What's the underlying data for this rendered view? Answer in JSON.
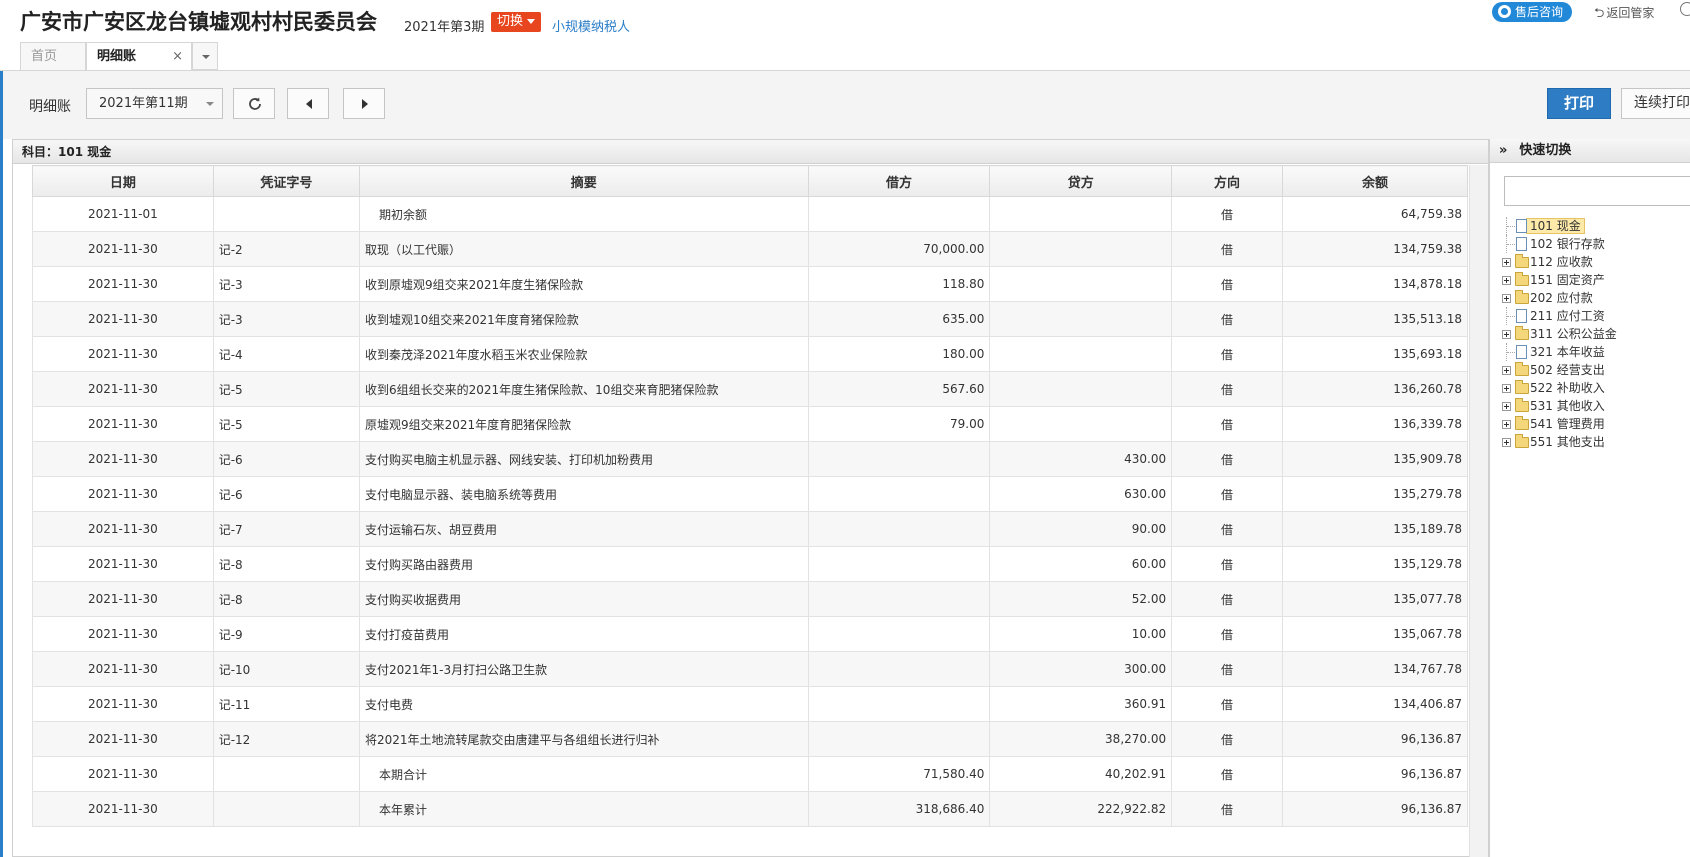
{
  "header": {
    "company": "广安市广安区龙台镇墟观村村民委员会",
    "period": "2021年第3期",
    "switch_label": "切换",
    "taxpayer": "小规模纳税人",
    "support_label": "售后咨询",
    "back_label": "返回管家"
  },
  "tabs": [
    {
      "label": "首页"
    },
    {
      "label": "明细账",
      "close": "×"
    }
  ],
  "toolbar": {
    "label": "明细账",
    "period_value": "2021年第11期",
    "print_label": "打印",
    "continuous_print_label": "连续打印"
  },
  "subject": "科目：101  现金",
  "columns": [
    "日期",
    "凭证字号",
    "摘要",
    "借方",
    "贷方",
    "方向",
    "余额"
  ],
  "rows": [
    {
      "date": "2021-11-01",
      "voucher": "",
      "summary": "期初余额",
      "debit": "",
      "credit": "",
      "dir": "借",
      "balance": "64,759.38",
      "indent": true
    },
    {
      "date": "2021-11-30",
      "voucher": "记-2",
      "summary": "取现（以工代赈）",
      "debit": "70,000.00",
      "credit": "",
      "dir": "借",
      "balance": "134,759.38"
    },
    {
      "date": "2021-11-30",
      "voucher": "记-3",
      "summary": "收到原墟观9组交来2021年度生猪保险款",
      "debit": "118.80",
      "credit": "",
      "dir": "借",
      "balance": "134,878.18"
    },
    {
      "date": "2021-11-30",
      "voucher": "记-3",
      "summary": "收到墟观10组交来2021年度育猪保险款",
      "debit": "635.00",
      "credit": "",
      "dir": "借",
      "balance": "135,513.18"
    },
    {
      "date": "2021-11-30",
      "voucher": "记-4",
      "summary": "收到秦茂泽2021年度水稻玉米农业保险款",
      "debit": "180.00",
      "credit": "",
      "dir": "借",
      "balance": "135,693.18"
    },
    {
      "date": "2021-11-30",
      "voucher": "记-5",
      "summary": "收到6组组长交来的2021年度生猪保险款、10组交来育肥猪保险款",
      "debit": "567.60",
      "credit": "",
      "dir": "借",
      "balance": "136,260.78"
    },
    {
      "date": "2021-11-30",
      "voucher": "记-5",
      "summary": "原墟观9组交来2021年度育肥猪保险款",
      "debit": "79.00",
      "credit": "",
      "dir": "借",
      "balance": "136,339.78"
    },
    {
      "date": "2021-11-30",
      "voucher": "记-6",
      "summary": "支付购买电脑主机显示器、网线安装、打印机加粉费用",
      "debit": "",
      "credit": "430.00",
      "dir": "借",
      "balance": "135,909.78"
    },
    {
      "date": "2021-11-30",
      "voucher": "记-6",
      "summary": "支付电脑显示器、装电脑系统等费用",
      "debit": "",
      "credit": "630.00",
      "dir": "借",
      "balance": "135,279.78"
    },
    {
      "date": "2021-11-30",
      "voucher": "记-7",
      "summary": "支付运输石灰、胡豆费用",
      "debit": "",
      "credit": "90.00",
      "dir": "借",
      "balance": "135,189.78"
    },
    {
      "date": "2021-11-30",
      "voucher": "记-8",
      "summary": "支付购买路由器费用",
      "debit": "",
      "credit": "60.00",
      "dir": "借",
      "balance": "135,129.78"
    },
    {
      "date": "2021-11-30",
      "voucher": "记-8",
      "summary": "支付购买收据费用",
      "debit": "",
      "credit": "52.00",
      "dir": "借",
      "balance": "135,077.78"
    },
    {
      "date": "2021-11-30",
      "voucher": "记-9",
      "summary": "支付打疫苗费用",
      "debit": "",
      "credit": "10.00",
      "dir": "借",
      "balance": "135,067.78"
    },
    {
      "date": "2021-11-30",
      "voucher": "记-10",
      "summary": "支付2021年1-3月打扫公路卫生款",
      "debit": "",
      "credit": "300.00",
      "dir": "借",
      "balance": "134,767.78"
    },
    {
      "date": "2021-11-30",
      "voucher": "记-11",
      "summary": "支付电费",
      "debit": "",
      "credit": "360.91",
      "dir": "借",
      "balance": "134,406.87"
    },
    {
      "date": "2021-11-30",
      "voucher": "记-12",
      "summary": "将2021年土地流转尾款交由唐建平与各组组长进行归补",
      "debit": "",
      "credit": "38,270.00",
      "dir": "借",
      "balance": "96,136.87"
    },
    {
      "date": "2021-11-30",
      "voucher": "",
      "summary": "本期合计",
      "debit": "71,580.40",
      "credit": "40,202.91",
      "dir": "借",
      "balance": "96,136.87",
      "indent": true
    },
    {
      "date": "2021-11-30",
      "voucher": "",
      "summary": "本年累计",
      "debit": "318,686.40",
      "credit": "222,922.82",
      "dir": "借",
      "balance": "96,136.87",
      "indent": true
    }
  ],
  "side": {
    "title": "快速切换",
    "search_value": "",
    "tree": [
      {
        "label": "101 现金",
        "type": "file",
        "selected": true
      },
      {
        "label": "102 银行存款",
        "type": "file"
      },
      {
        "label": "112 应收款",
        "type": "folder"
      },
      {
        "label": "151 固定资产",
        "type": "folder"
      },
      {
        "label": "202 应付款",
        "type": "folder"
      },
      {
        "label": "211 应付工资",
        "type": "file"
      },
      {
        "label": "311 公积公益金",
        "type": "folder"
      },
      {
        "label": "321 本年收益",
        "type": "file"
      },
      {
        "label": "502 经营支出",
        "type": "folder"
      },
      {
        "label": "522 补助收入",
        "type": "folder"
      },
      {
        "label": "531 其他收入",
        "type": "folder"
      },
      {
        "label": "541 管理费用",
        "type": "folder"
      },
      {
        "label": "551 其他支出",
        "type": "folder"
      }
    ]
  }
}
